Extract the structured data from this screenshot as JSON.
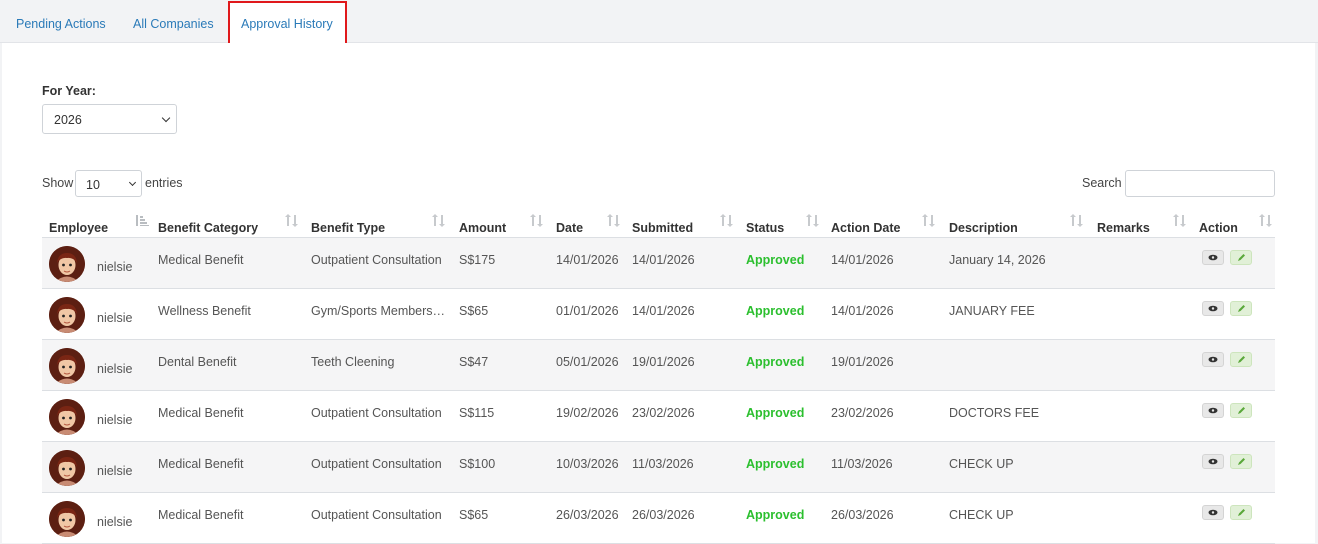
{
  "tabs": [
    {
      "label": "Pending Actions"
    },
    {
      "label": "All Companies"
    },
    {
      "label": "Approval History"
    }
  ],
  "filter": {
    "for_year_label": "For Year:",
    "year": "2026"
  },
  "table_controls": {
    "show_label": "Show",
    "entries_value": "10",
    "entries_label": "entries",
    "search_label": "Search",
    "search_value": ""
  },
  "columns": [
    "Employee",
    "Benefit Category",
    "Benefit Type",
    "Amount",
    "Date",
    "Submitted",
    "Status",
    "Action Date",
    "Description",
    "Remarks",
    "Action"
  ],
  "rows": [
    {
      "employee": "nielsie",
      "category": "Medical Benefit",
      "type": "Outpatient Consultation",
      "amount": "S$175",
      "date": "14/01/2026",
      "submitted": "14/01/2026",
      "status": "Approved",
      "action_date": "14/01/2026",
      "description": "January 14, 2026",
      "remarks": ""
    },
    {
      "employee": "nielsie",
      "category": "Wellness Benefit",
      "type": "Gym/Sports Members…",
      "amount": "S$65",
      "date": "01/01/2026",
      "submitted": "14/01/2026",
      "status": "Approved",
      "action_date": "14/01/2026",
      "description": "JANUARY FEE",
      "remarks": ""
    },
    {
      "employee": "nielsie",
      "category": "Dental Benefit",
      "type": "Teeth Cleening",
      "amount": "S$47",
      "date": "05/01/2026",
      "submitted": "19/01/2026",
      "status": "Approved",
      "action_date": "19/01/2026",
      "description": "",
      "remarks": ""
    },
    {
      "employee": "nielsie",
      "category": "Medical Benefit",
      "type": "Outpatient Consultation",
      "amount": "S$115",
      "date": "19/02/2026",
      "submitted": "23/02/2026",
      "status": "Approved",
      "action_date": "23/02/2026",
      "description": "DOCTORS FEE",
      "remarks": ""
    },
    {
      "employee": "nielsie",
      "category": "Medical Benefit",
      "type": "Outpatient Consultation",
      "amount": "S$100",
      "date": "10/03/2026",
      "submitted": "11/03/2026",
      "status": "Approved",
      "action_date": "11/03/2026",
      "description": "CHECK UP",
      "remarks": ""
    },
    {
      "employee": "nielsie",
      "category": "Medical Benefit",
      "type": "Outpatient Consultation",
      "amount": "S$65",
      "date": "26/03/2026",
      "submitted": "26/03/2026",
      "status": "Approved",
      "action_date": "26/03/2026",
      "description": "CHECK UP",
      "remarks": ""
    }
  ],
  "colors": {
    "link": "#2a7ab8",
    "status_approved": "#2bbf2e",
    "highlight_border": "#e0181b"
  },
  "icons": {
    "view": "eye-icon",
    "edit": "pencil-icon",
    "sort": "sort-icon",
    "dropdown": "chevron-down-icon"
  }
}
